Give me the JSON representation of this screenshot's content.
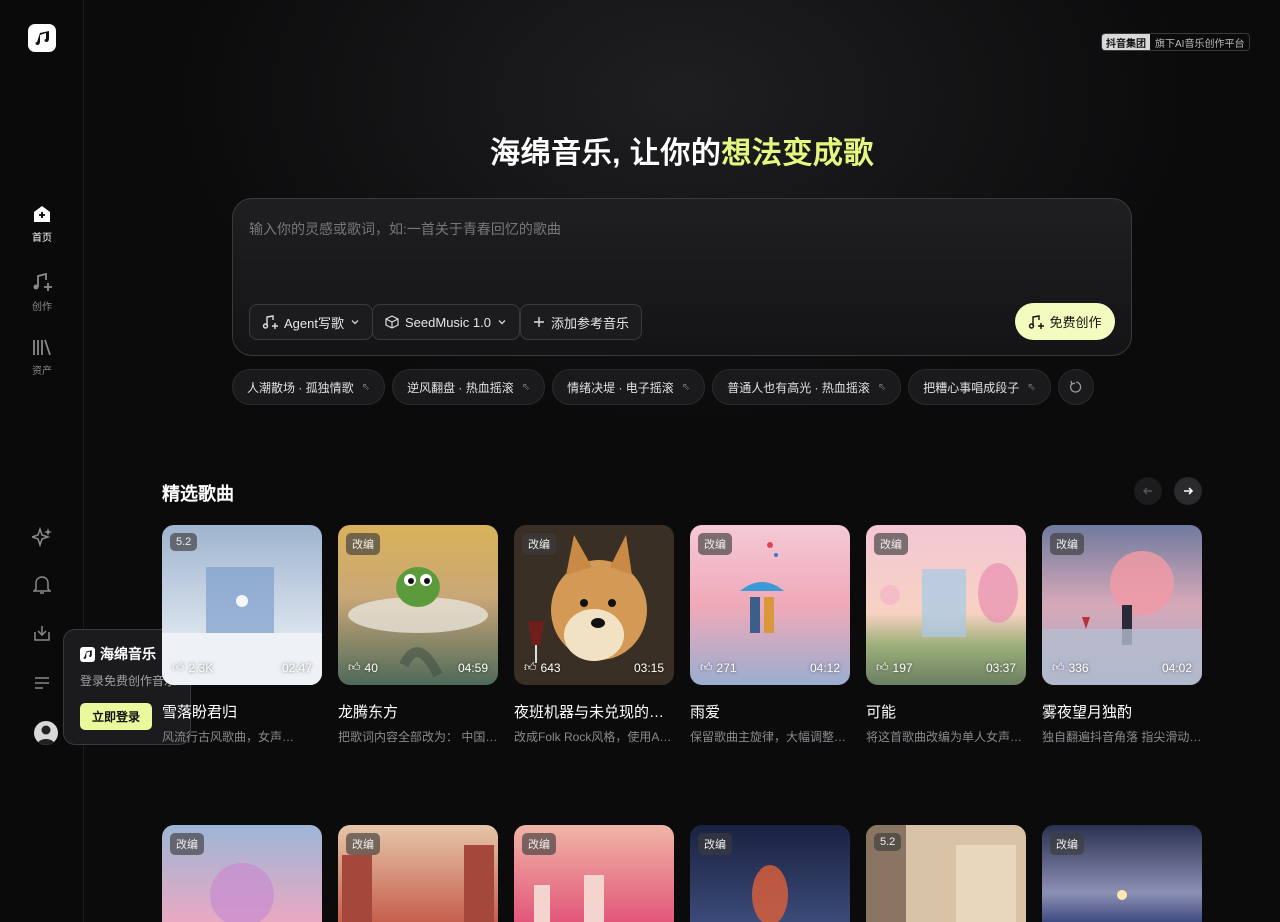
{
  "brand": {
    "badge_group": "抖音集团",
    "badge_text": "旗下AI音乐创作平台"
  },
  "sidebar": {
    "items": [
      {
        "label": "首页",
        "icon": "home-icon"
      },
      {
        "label": "创作",
        "icon": "music-create-icon"
      },
      {
        "label": "资产",
        "icon": "library-icon"
      }
    ],
    "bottom_icons": [
      "sparkle-icon",
      "bell-icon",
      "download-icon",
      "menu-icon",
      "user-avatar-icon"
    ]
  },
  "login_popup": {
    "brand": "海绵音乐",
    "subtitle": "登录免费创作音乐",
    "button": "立即登录"
  },
  "hero": {
    "title_plain": "海绵音乐, 让你的",
    "title_highlight": "想法变成歌",
    "placeholder": "输入你的灵感或歌词，如:一首关于青春回忆的歌曲",
    "pill_agent": "Agent写歌",
    "pill_model": "SeedMusic 1.0",
    "pill_ref": "添加参考音乐",
    "create_button": "免费创作"
  },
  "chips": [
    "人潮散场 · 孤独情歌",
    "逆风翻盘 · 热血摇滚",
    "情绪决堤 · 电子摇滚",
    "普通人也有高光 · 热血摇滚",
    "把糟心事唱成段子"
  ],
  "section": {
    "title": "精选歌曲"
  },
  "songs": [
    {
      "tag": "5.2",
      "likes": "2.3K",
      "duration": "02:47",
      "title": "雪落盼君归",
      "desc": "风流行古风歌曲，女声…"
    },
    {
      "tag": "改编",
      "likes": "40",
      "duration": "04:59",
      "title": "龙腾东方",
      "desc": "把歌词内容全部改为：  中国…"
    },
    {
      "tag": "改编",
      "likes": "643",
      "duration": "03:15",
      "title": "夜班机器与未兑现的…",
      "desc": "改成Folk Rock风格，使用A…"
    },
    {
      "tag": "改编",
      "likes": "271",
      "duration": "04:12",
      "title": "雨爱",
      "desc": "保留歌曲主旋律，大幅调整…"
    },
    {
      "tag": "改编",
      "likes": "197",
      "duration": "03:37",
      "title": "可能",
      "desc": "将这首歌曲改编为单人女声…"
    },
    {
      "tag": "改编",
      "likes": "336",
      "duration": "04:02",
      "title": "雾夜望月独酌",
      "desc": "独自翻遍抖音角落 指尖滑动…"
    }
  ],
  "songs_row2_tags": [
    "改编",
    "改编",
    "改编",
    "改编",
    "5.2",
    "改编"
  ],
  "colors": {
    "accent": "#e6f77f",
    "create_btn": "#f3fbbf",
    "bg": "#0b0b0c"
  }
}
